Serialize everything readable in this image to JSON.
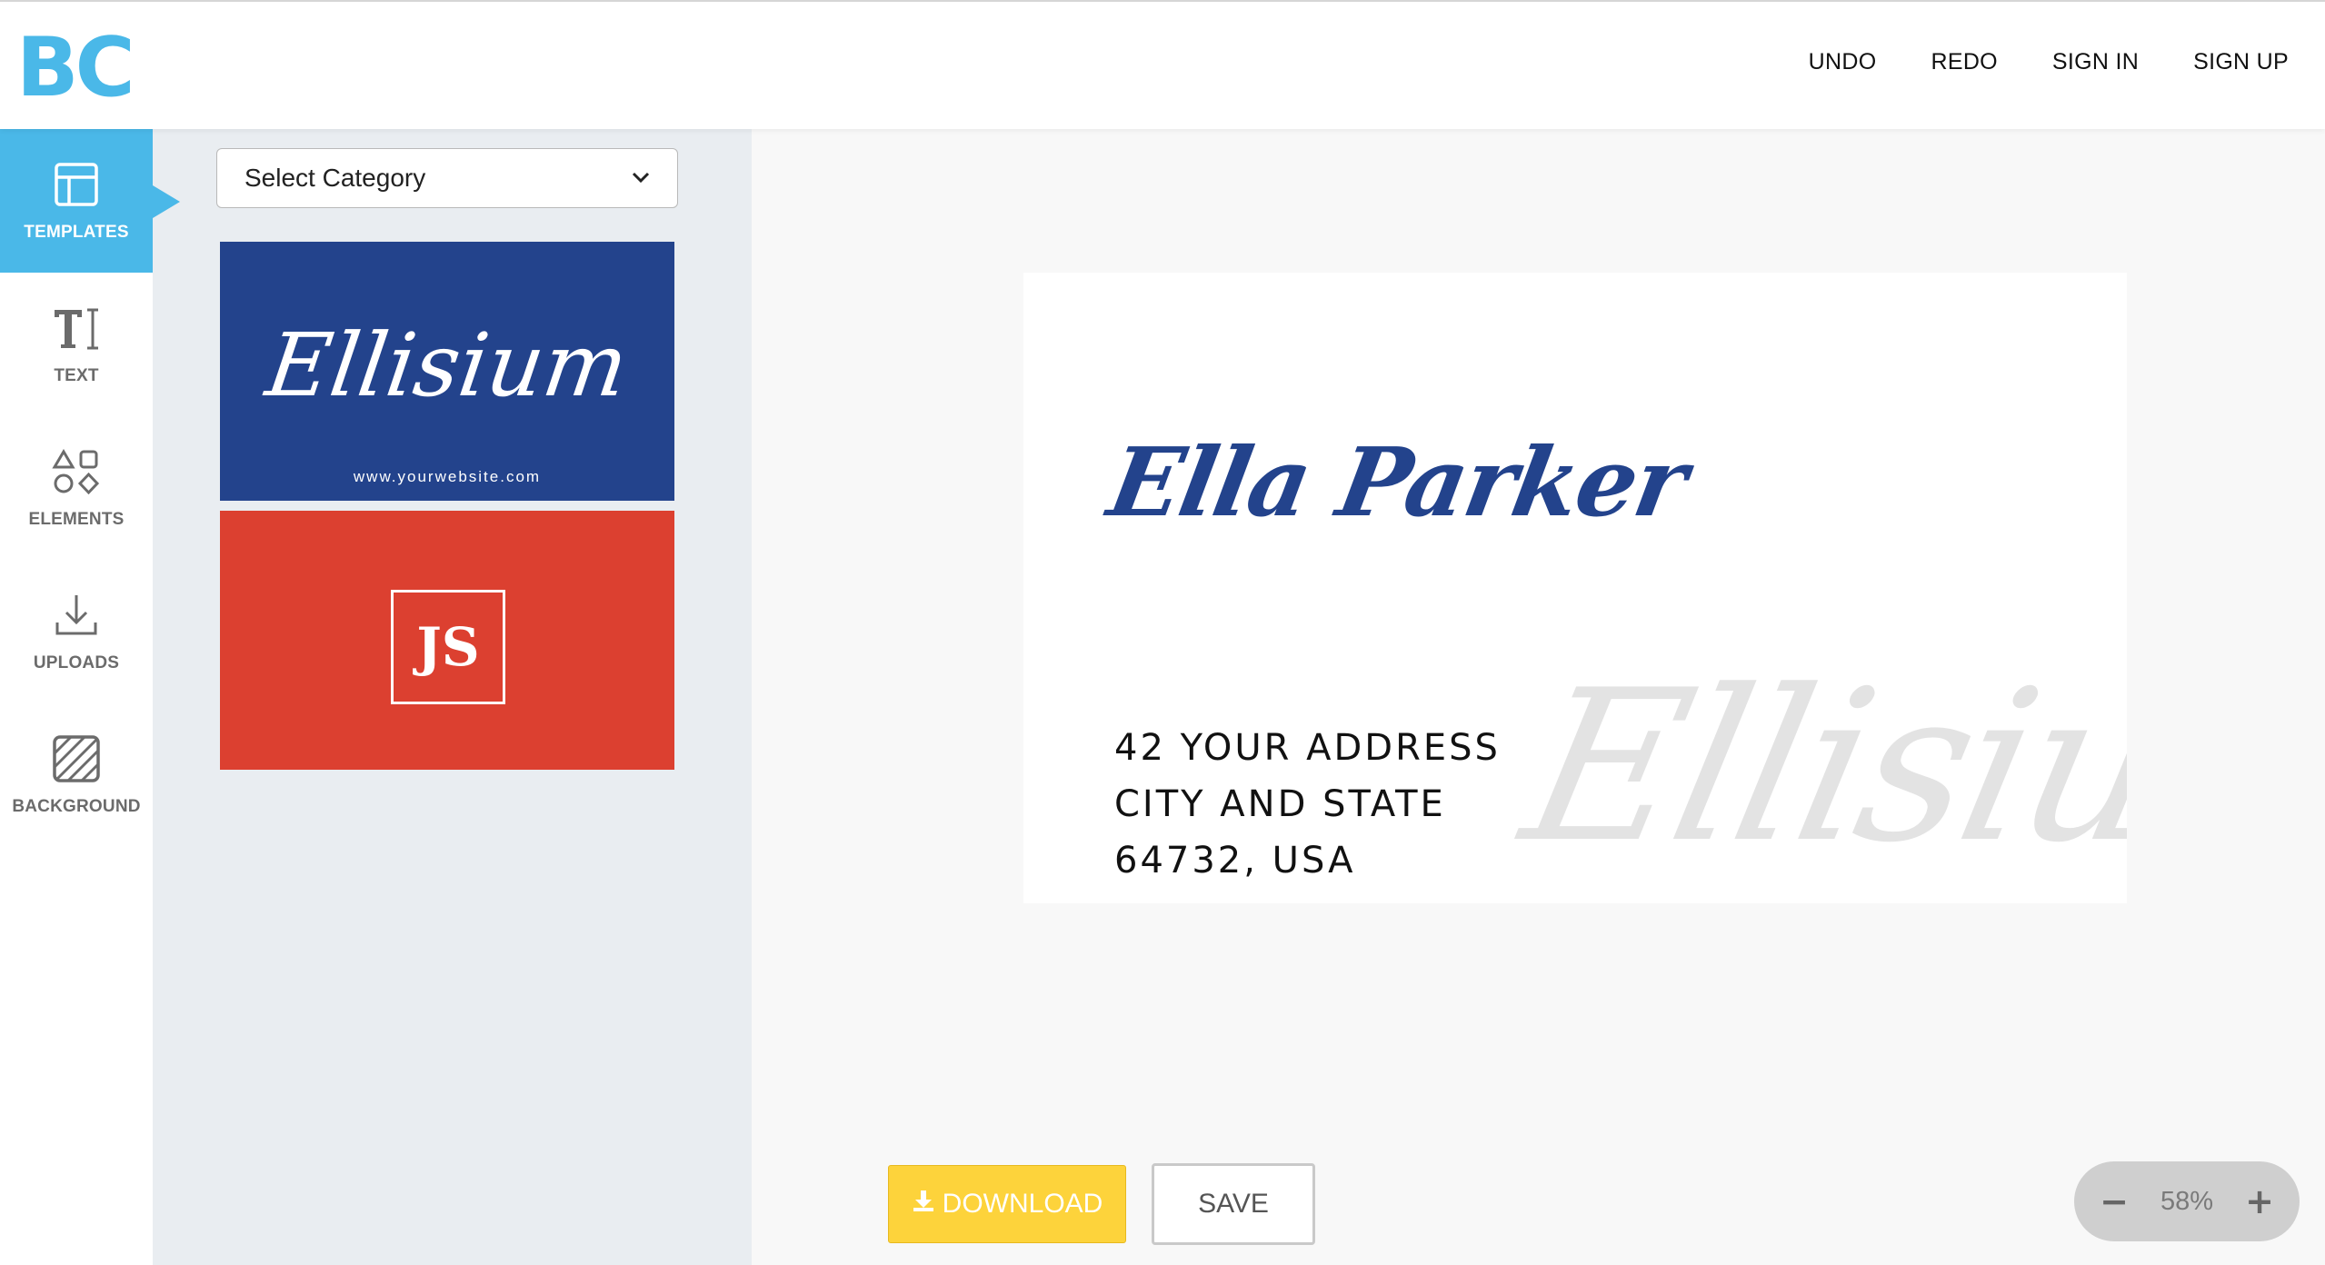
{
  "app": {
    "logo": "BC"
  },
  "header": {
    "nav": {
      "undo": "UNDO",
      "redo": "REDO",
      "sign_in": "SIGN IN",
      "sign_up": "SIGN UP"
    }
  },
  "sidebar": {
    "items": [
      {
        "label": "TEMPLATES",
        "icon": "templates-icon",
        "active": true
      },
      {
        "label": "TEXT",
        "icon": "text-icon",
        "active": false
      },
      {
        "label": "ELEMENTS",
        "icon": "shapes-icon",
        "active": false
      },
      {
        "label": "UPLOADS",
        "icon": "download-icon",
        "active": false
      },
      {
        "label": "BACKGROUND",
        "icon": "background-pattern-icon",
        "active": false
      }
    ]
  },
  "templates_panel": {
    "category_select": {
      "selected": "Select Category"
    },
    "templates": [
      {
        "script_text": "Ellisium",
        "url_text": "www.yourwebsite.com",
        "background": "#23438c"
      },
      {
        "monogram": "JS",
        "background": "#dc4030"
      }
    ]
  },
  "card": {
    "name": "Ella Parker",
    "address_lines": [
      "42 YOUR ADDRESS",
      "CITY AND STATE",
      "64732, USA"
    ],
    "watermark": "Ellisium"
  },
  "actions": {
    "download_label": "DOWNLOAD",
    "save_label": "SAVE"
  },
  "zoom": {
    "minus_label": "−",
    "plus_label": "+",
    "value": "58%"
  },
  "colors": {
    "accent": "#4ab8e8",
    "brand_blue": "#23438c",
    "brand_red": "#dc4030",
    "download": "#fdd33b"
  }
}
